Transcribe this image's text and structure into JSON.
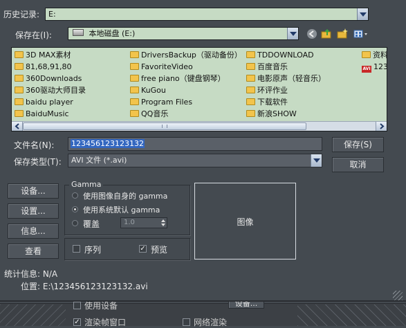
{
  "history": {
    "label": "历史记录:",
    "value": "E:"
  },
  "save_in": {
    "label": "保存在(I):",
    "value": "本地磁盘 (E:)"
  },
  "files": [
    {
      "name": "3D MAX素材",
      "type": "folder"
    },
    {
      "name": "81,68,91,80",
      "type": "folder"
    },
    {
      "name": "360Downloads",
      "type": "folder"
    },
    {
      "name": "360驱动大师目录",
      "type": "folder"
    },
    {
      "name": "baidu player",
      "type": "folder"
    },
    {
      "name": "BaiduMusic",
      "type": "folder"
    },
    {
      "name": "DriversBackup（驱动备份）",
      "type": "folder"
    },
    {
      "name": "FavoriteVideo",
      "type": "folder"
    },
    {
      "name": "free piano（键盘钢琴）",
      "type": "folder"
    },
    {
      "name": "KuGou",
      "type": "folder"
    },
    {
      "name": "Program Files",
      "type": "folder"
    },
    {
      "name": "QQ音乐",
      "type": "folder"
    },
    {
      "name": "TDDOWNLOAD",
      "type": "folder"
    },
    {
      "name": "百度音乐",
      "type": "folder"
    },
    {
      "name": "电影原声（轻音乐）",
      "type": "folder"
    },
    {
      "name": "环评作业",
      "type": "folder"
    },
    {
      "name": "下载软件",
      "type": "folder"
    },
    {
      "name": "新浪SHOW",
      "type": "folder"
    },
    {
      "name": "资料",
      "type": "folder"
    },
    {
      "name": "123",
      "type": "avi"
    }
  ],
  "filename": {
    "label": "文件名(N):",
    "value": "123456123123132"
  },
  "filetype": {
    "label": "保存类型(T):",
    "value": "AVI 文件 (*.avi)"
  },
  "buttons": {
    "save": "保存(S)",
    "cancel": "取消",
    "devices": "设备...",
    "setup": "设置...",
    "info": "信息...",
    "view": "查看"
  },
  "gamma": {
    "title": "Gamma",
    "opt_own": "使用图像自身的 gamma",
    "opt_system": "使用系统默认 gamma",
    "opt_override": "覆盖",
    "override_value": "1.0"
  },
  "sequence_label": "序列",
  "preview_label": "预览",
  "preview_box": "图像",
  "stats": {
    "label": "统计信息: N/A",
    "location": "位置: E:\\123456123123132.avi"
  },
  "background": {
    "use_device": "使用设备",
    "render_frame_window": "渲染帧窗口",
    "net_render": "网络渲染",
    "device_btn": "设备..."
  },
  "icons": [
    "drive-icon",
    "back-icon",
    "up-folder-icon",
    "new-folder-icon",
    "view-menu-icon",
    "folder-icon",
    "avi-file-icon"
  ],
  "colors": {
    "dialog_bg": "#444a50",
    "field_bg": "#c6dbc4",
    "selection": "#3367c0"
  }
}
